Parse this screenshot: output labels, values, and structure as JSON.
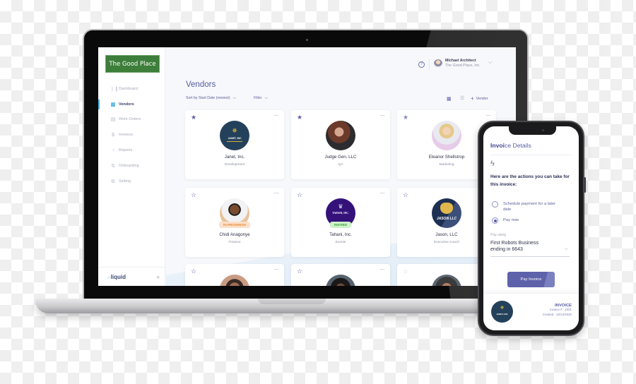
{
  "laptop": {
    "sidebar": {
      "logo": "The Good Place",
      "nav": [
        {
          "label": "Dashboard",
          "icon": "bar-chart-icon",
          "glyph": "❘❙",
          "active": false
        },
        {
          "label": "Vendors",
          "icon": "building-icon",
          "glyph": "▥",
          "active": true
        },
        {
          "label": "Work Orders",
          "icon": "document-icon",
          "glyph": "▤",
          "active": false
        },
        {
          "label": "Invoices",
          "icon": "dollar-icon",
          "glyph": "$",
          "active": false
        },
        {
          "label": "Reports",
          "icon": "pie-chart-icon",
          "glyph": "◔",
          "active": false
        },
        {
          "label": "Onboarding",
          "icon": "transfer-icon",
          "glyph": "⇅",
          "active": false
        },
        {
          "label": "Setting",
          "icon": "gear-icon",
          "glyph": "⚙",
          "active": false
        }
      ],
      "brand": "liquid",
      "brand_glyph": "○",
      "collapse_glyph": "«"
    },
    "header": {
      "help_glyph": "?",
      "user_name": "Michael Architect",
      "user_org": "The Good Place, Inc.",
      "chevron": "⌵"
    },
    "toolbar": {
      "title": "Vendors",
      "sort_label": "Sort by Start Date (newest)",
      "filter_label": "Filter",
      "chevron": "⌵",
      "grid_glyph": "▦",
      "list_glyph": "☰",
      "add_glyph": "+",
      "add_label": "Vendor"
    },
    "vendors": [
      {
        "name": "Janet, Inc.",
        "dept": "Development",
        "starred": true,
        "badge": null,
        "logo_text": "JANET, INC"
      },
      {
        "name": "Judge Gen, LLC",
        "dept": "QA",
        "starred": true,
        "badge": null
      },
      {
        "name": "Eleanor Shellstrop",
        "dept": "Marketing",
        "starred": true,
        "badge": null
      },
      {
        "name": "Chidi Anagonye",
        "dept": "Finance",
        "starred": false,
        "badge": "IN PROGRESS"
      },
      {
        "name": "Tahani, Inc.",
        "dept": "Events",
        "starred": false,
        "badge": "INVITED",
        "logo_text": "TAHANI, INC."
      },
      {
        "name": "Jason, LLC",
        "dept": "Executive Coach",
        "starred": false,
        "badge": null,
        "logo_text": "JASON LLC"
      },
      {
        "name": "",
        "dept": "",
        "starred": false
      },
      {
        "name": "",
        "dept": "",
        "starred": false
      },
      {
        "name": "",
        "dept": "",
        "starred": false
      }
    ],
    "glyphs": {
      "star_filled": "★",
      "star_empty": "☆",
      "more": "···",
      "bulb": "✵",
      "crown": "♛"
    }
  },
  "phone": {
    "title_bold": "Invoi",
    "title_rest": "ce Details",
    "bolt_glyph": "ϟ",
    "heading": "Here are the actions you can take for this invoice:",
    "options": [
      {
        "label": "Schedule payment for a later date",
        "selected": false
      },
      {
        "label": "Pay now",
        "selected": true
      }
    ],
    "pay_using_label": "Pay using",
    "pay_using_value": "First Robots Business ending in 6643",
    "chevron": "⌵",
    "button": "Pay Invoice",
    "invoice": {
      "heading": "INVOICE",
      "number": "Invoice # : 1001",
      "created": "Created : 10/13/2020",
      "logo_text": "JANET, INC"
    }
  },
  "colors": {
    "brand_green": "#3d7e3a",
    "accent_purple": "#5b60a6",
    "accent_blue": "#46b5e2"
  }
}
